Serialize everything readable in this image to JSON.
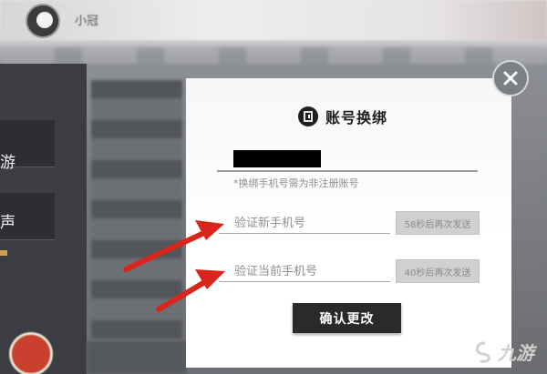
{
  "background": {
    "player_name": "小冠",
    "left_menu_chars": [
      "游",
      "声"
    ]
  },
  "dialog": {
    "title": "账号换绑",
    "current_phone_masked": "",
    "hint": "*换绑手机号需为非注册账号",
    "new_phone": {
      "placeholder": "验证新手机号",
      "send_label": "58秒后再次发送"
    },
    "current_phone": {
      "placeholder": "验证当前手机号",
      "send_label": "40秒后再次发送"
    },
    "confirm_label": "确认更改",
    "close_icon": "close-icon"
  },
  "annotations": {
    "arrow_color": "#d8261c"
  },
  "watermark": {
    "text": "九游",
    "icon": "jiuyou-logo-icon"
  },
  "colors": {
    "dialog_bg": "#ffffff",
    "confirm_bg": "#2a2a2a",
    "send_bg": "#d0d0d0"
  }
}
